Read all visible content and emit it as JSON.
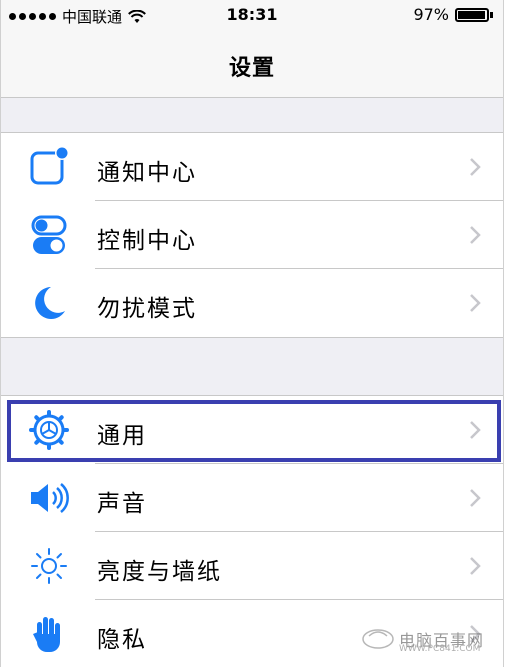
{
  "status_bar": {
    "carrier": "中国联通",
    "time": "18:31",
    "battery": "97%",
    "battery_level": 0.97
  },
  "nav": {
    "title": "设置"
  },
  "groups": [
    {
      "items": [
        {
          "label": "通知中心",
          "icon": "notification-center-icon"
        },
        {
          "label": "控制中心",
          "icon": "control-center-icon"
        },
        {
          "label": "勿扰模式",
          "icon": "do-not-disturb-moon-icon"
        }
      ]
    },
    {
      "items": [
        {
          "label": "通用",
          "icon": "general-gear-icon",
          "highlighted": true
        },
        {
          "label": "声音",
          "icon": "sound-speaker-icon"
        },
        {
          "label": "亮度与墙纸",
          "icon": "brightness-sun-icon"
        },
        {
          "label": "隐私",
          "icon": "privacy-hand-icon"
        }
      ]
    }
  ],
  "colors": {
    "accent": "#1a7cf5",
    "highlight_border": "#3a3fb0",
    "group_bg": "#efeff4"
  },
  "watermark": {
    "text": "电脑百事网",
    "sub": "WWW.PC841.COM"
  }
}
